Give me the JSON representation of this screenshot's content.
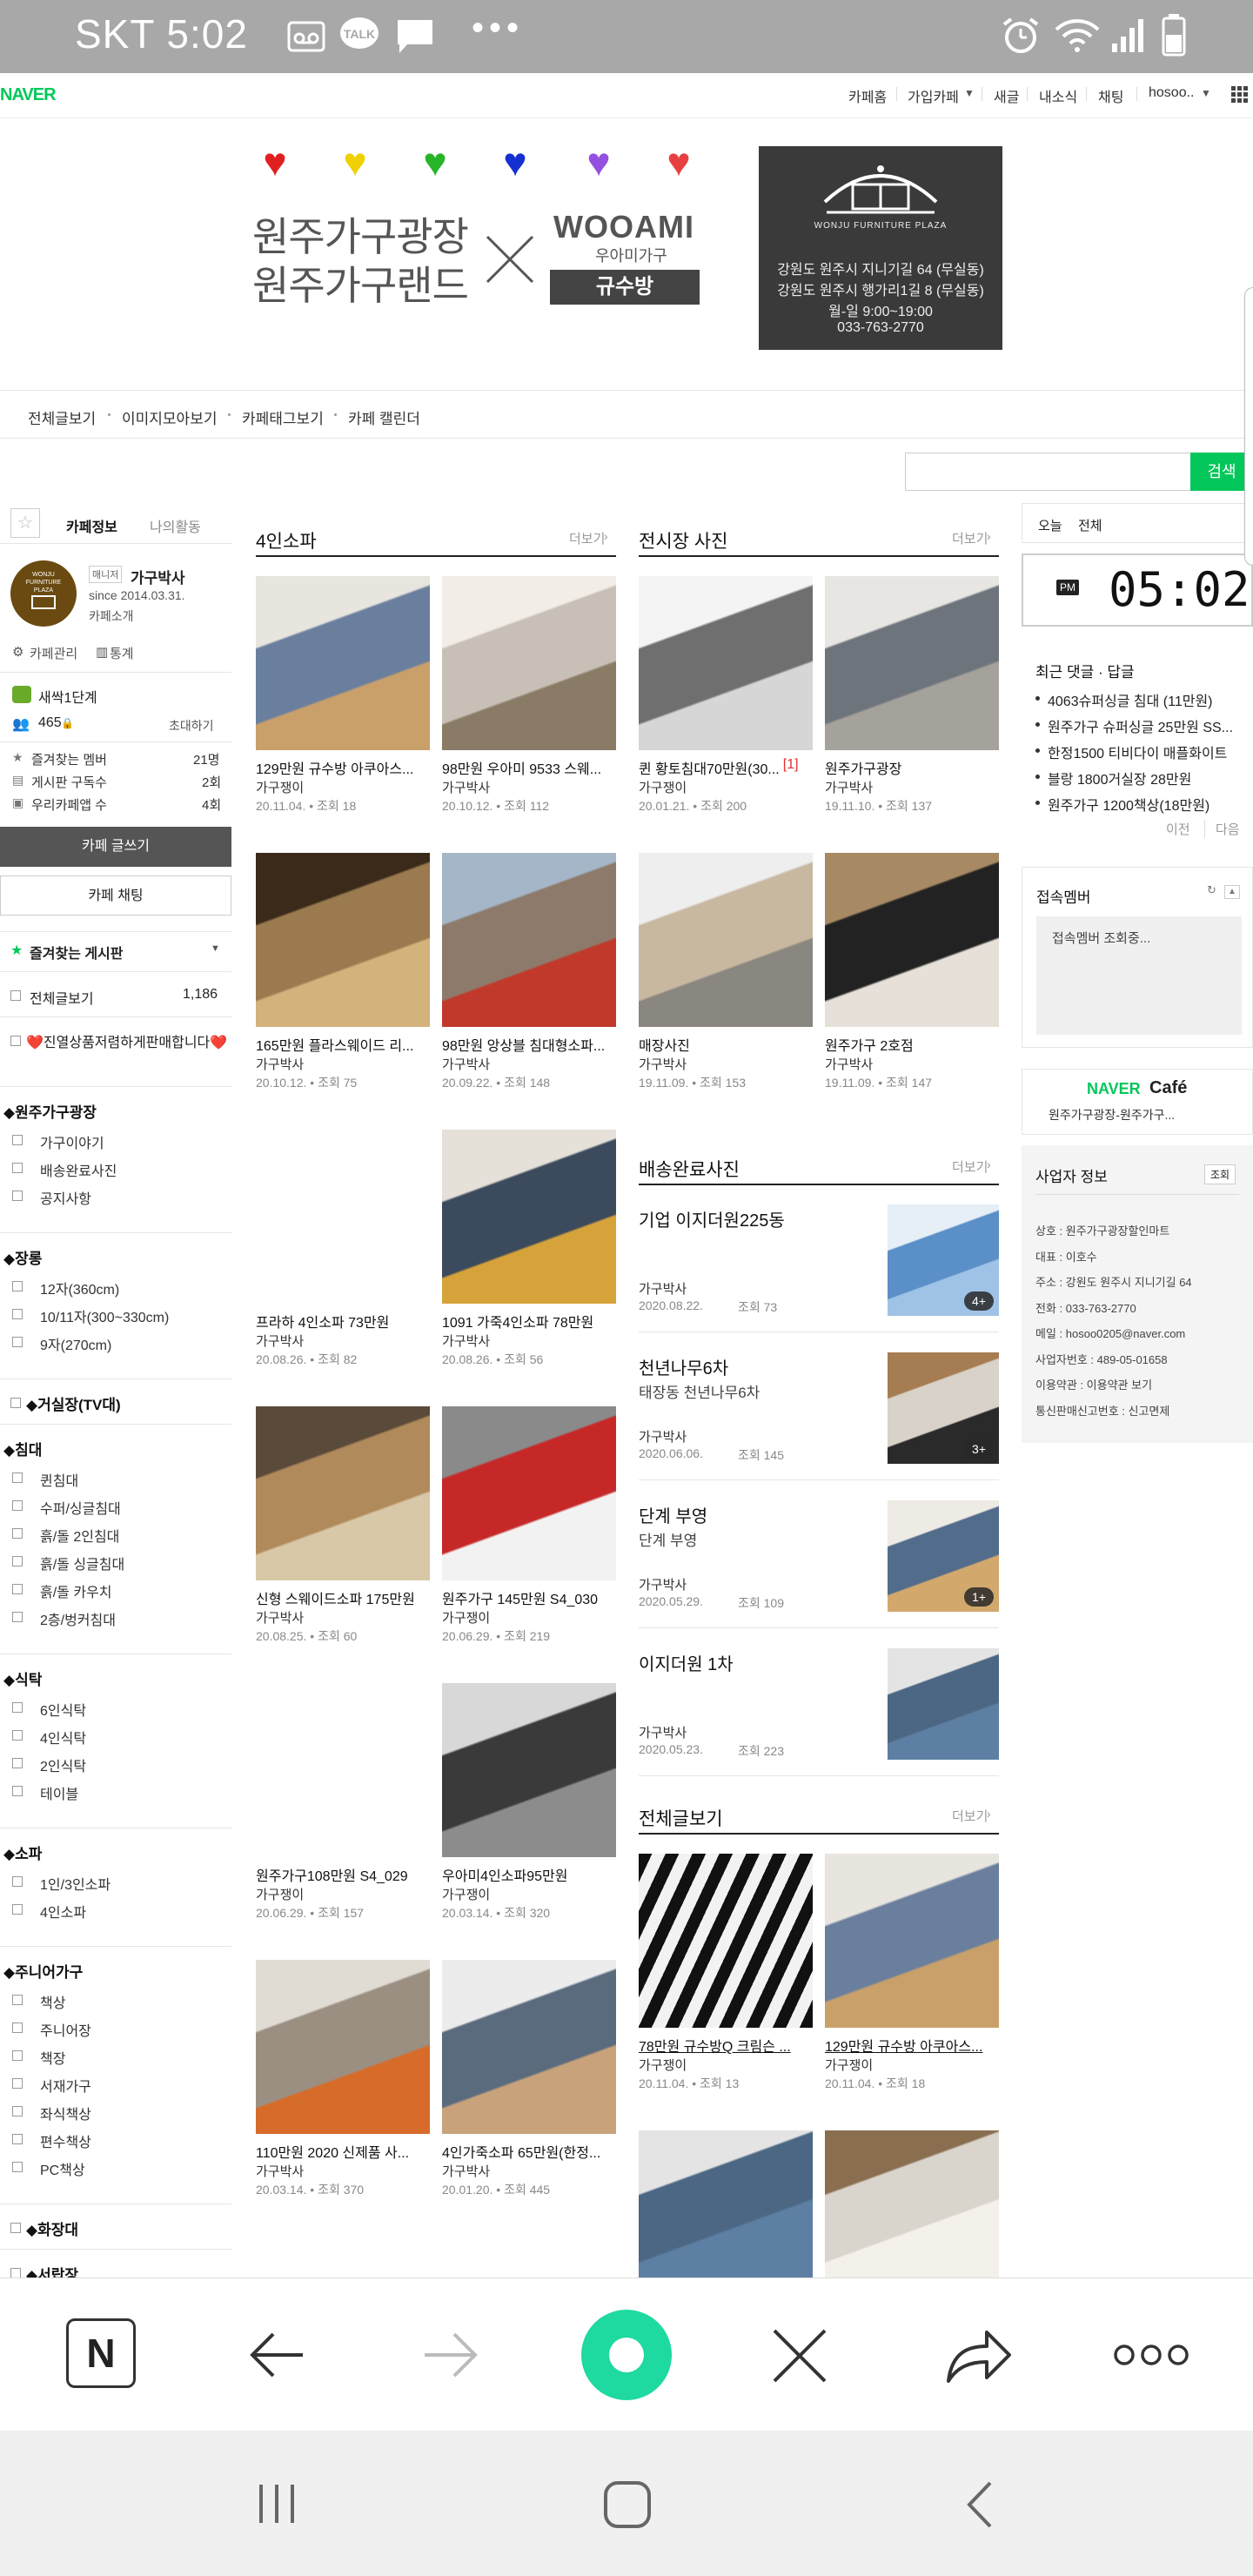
{
  "status_bar": {
    "carrier_time": "SKT 5:02",
    "dots": "•••",
    "icons": [
      "voicemail-icon",
      "talk-icon",
      "message-icon",
      "alarm-icon",
      "wifi-icon",
      "signal-icon",
      "battery-icon"
    ]
  },
  "gnb": {
    "logo": "NAVER",
    "items": [
      "카페홈",
      "가입카페",
      "새글",
      "내소식",
      "채팅",
      "hosoo.."
    ]
  },
  "banner": {
    "title1": "원주가구광장",
    "title2": "원주가구랜드",
    "x": "X",
    "brand": "WOOAMI",
    "brand_sub": "우아미가구",
    "kyusu": "규수방",
    "store_eng": "WONJU FURNITURE PLAZA",
    "addr1": "강원도 원주시 지니기길 64 (무실동)",
    "addr2": "강원도 원주시 행가리1길 8 (무실동)",
    "hours": "월-일 9:00~19:00",
    "phone": "033-763-2770"
  },
  "cafe_menu": [
    "전체글보기",
    "이미지모아보기",
    "카페태그보기",
    "카페 캘린더"
  ],
  "search": {
    "button": "검색",
    "placeholder": ""
  },
  "left": {
    "tabs": [
      "카페정보",
      "나의활동"
    ],
    "manager_tag": "매니저",
    "manager_name": "가구박사",
    "since": "since 2014.03.31.",
    "intro": "카페소개",
    "manage": "카페관리",
    "stats": "통계",
    "level": "새싹1단계",
    "members": "465",
    "invite": "초대하기",
    "rows": [
      {
        "label": "즐겨찾는 멤버",
        "value": "21명"
      },
      {
        "label": "게시판 구독수",
        "value": "2회"
      },
      {
        "label": "우리카페앱 수",
        "value": "4회"
      }
    ],
    "write_btn": "카페 글쓰기",
    "chat_btn": "카페 채팅",
    "fav_boards": "즐겨찾는 게시판",
    "all_posts": "전체글보기",
    "all_count": "1,186",
    "notice": "❤️진열상품저렴하게판매합니다❤️",
    "sections": [
      {
        "title": "◆원주가구광장",
        "items": [
          "가구이야기",
          "배송완료사진",
          "공지사항"
        ]
      },
      {
        "title": "◆장롱",
        "items": [
          "12자(360cm)",
          "10/11자(300~330cm)",
          "9자(270cm)"
        ]
      },
      {
        "title": "◆거실장(TV대)",
        "items": []
      },
      {
        "title": "◆침대",
        "items": [
          "퀸침대",
          "수퍼/싱글침대",
          "흙/돌 2인침대",
          "흙/돌 싱글침대",
          "흙/돌 카우치",
          "2층/벙커침대"
        ]
      },
      {
        "title": "◆식탁",
        "items": [
          "6인식탁",
          "4인식탁",
          "2인식탁",
          "테이블"
        ]
      },
      {
        "title": "◆소파",
        "items": [
          "1인/3인소파",
          "4인소파"
        ]
      },
      {
        "title": "◆주니어가구",
        "items": [
          "책상",
          "주니어장",
          "책장",
          "서재가구",
          "좌식책상",
          "편수책상",
          "PC책상"
        ]
      },
      {
        "title": "◆화장대",
        "items": []
      },
      {
        "title": "◆서랍장",
        "items": []
      }
    ]
  },
  "sofa": {
    "title": "4인소파",
    "more": "더보기",
    "posts": [
      {
        "title": "129만원 규수방 아쿠아스...",
        "author": "가구쟁이",
        "meta": "20.11.04. • 조회 18"
      },
      {
        "title": "98만원 우아미 9533 스웨...",
        "author": "가구박사",
        "meta": "20.10.12. • 조회 112"
      },
      {
        "title": "165만원 플라스웨이드 리...",
        "author": "가구박사",
        "meta": "20.10.12. • 조회 75"
      },
      {
        "title": "98만원 앙상블 침대형소파...",
        "author": "가구박사",
        "meta": "20.09.22. • 조회 148"
      },
      {
        "title": "프라하 4인소파 73만원",
        "author": "가구박사",
        "meta": "20.08.26. • 조회 82"
      },
      {
        "title": "1091 가죽4인소파 78만원",
        "author": "가구박사",
        "meta": "20.08.26. • 조회 56"
      },
      {
        "title": "신형 스웨이드소파 175만원",
        "author": "가구박사",
        "meta": "20.08.25. • 조회 60"
      },
      {
        "title": "원주가구 145만원 S4_030",
        "author": "가구쟁이",
        "meta": "20.06.29. • 조회 219"
      },
      {
        "title": "원주가구108만원 S4_029",
        "author": "가구쟁이",
        "meta": "20.06.29. • 조회 157"
      },
      {
        "title": "우아미4인소파95만원",
        "author": "가구쟁이",
        "meta": "20.03.14. • 조회 320"
      },
      {
        "title": "110만원 2020 신제품 사...",
        "author": "가구박사",
        "meta": "20.03.14. • 조회 370"
      },
      {
        "title": "4인가죽소파 65만원(한정...",
        "author": "가구박사",
        "meta": "20.01.20. • 조회 445"
      }
    ]
  },
  "showroom": {
    "title": "전시장 사진",
    "more": "더보기",
    "posts": [
      {
        "title": "퀸 황토침대70만원(30...",
        "comments": "[1]",
        "author": "가구쟁이",
        "meta": "20.01.21. • 조회 200"
      },
      {
        "title": "원주가구광장",
        "comments": "",
        "author": "가구박사",
        "meta": "19.11.10. • 조회 137"
      },
      {
        "title": "매장사진",
        "comments": "",
        "author": "가구박사",
        "meta": "19.11.09. • 조회 153"
      },
      {
        "title": "원주가구 2호점",
        "comments": "",
        "author": "가구박사",
        "meta": "19.11.09. • 조회 147"
      }
    ]
  },
  "delivery": {
    "title": "배송완료사진",
    "more": "더보기",
    "posts": [
      {
        "title": "기업 이지더원225동",
        "sub": "",
        "author": "가구박사",
        "date": "2020.08.22.",
        "views": "조회 73",
        "count": "4+"
      },
      {
        "title": "천년나무6차",
        "sub": "태장동 천년나무6차",
        "author": "가구박사",
        "date": "2020.06.06.",
        "views": "조회 145",
        "count": "3+"
      },
      {
        "title": "단계 부영",
        "sub": "단계 부영",
        "author": "가구박사",
        "date": "2020.05.29.",
        "views": "조회 109",
        "count": "1+"
      },
      {
        "title": "이지더원 1차",
        "sub": "",
        "author": "가구박사",
        "date": "2020.05.23.",
        "views": "조회 223",
        "count": ""
      }
    ]
  },
  "allposts": {
    "title": "전체글보기",
    "more": "더보기",
    "posts": [
      {
        "title": "78만원 규수방Q 크림슨 ...",
        "author": "가구쟁이",
        "meta": "20.11.04. • 조회 13"
      },
      {
        "title": "129만원 규수방 아쿠아스...",
        "author": "가구쟁이",
        "meta": "20.11.04. • 조회 18"
      }
    ]
  },
  "right": {
    "tabs": [
      "오늘",
      "전체"
    ],
    "clock_ampm": "PM",
    "clock_time": "05:02",
    "recent_title": "최근 댓글 · 답글",
    "recent": [
      "4063슈퍼싱글 침대 (11만원)",
      "원주가구 슈퍼싱글 25만원 SS...",
      "한정1500 티비다이 매플화이트",
      "블랑 1800거실장 28만원",
      "원주가구 1200책상(18만원)"
    ],
    "prev": "이전",
    "next": "다음",
    "online_title": "접속멤버",
    "online_placeholder": "접속멤버 조회중...",
    "cafe_logo_naver": "NAVER",
    "cafe_logo_cafe": "Café",
    "cafe_name": "원주가구광장-원주가구...",
    "biz_title": "사업자 정보",
    "biz_btn": "조회",
    "biz": [
      "상호 : 원주가구광장할인마트",
      "대표 : 이호수",
      "주소 : 강원도 원주시 지니기길 64",
      "전화 : 033-763-2770",
      "메일 : hosoo0205@naver.com",
      "사업자번호 : 489-05-01658",
      "이용약관 : 이용약관 보기",
      "통신판매신고번호 : 신고면제"
    ]
  },
  "toolbar": {
    "n": "N"
  },
  "colors": {
    "accent": "#03c75a",
    "status": "#a8a8a8"
  }
}
